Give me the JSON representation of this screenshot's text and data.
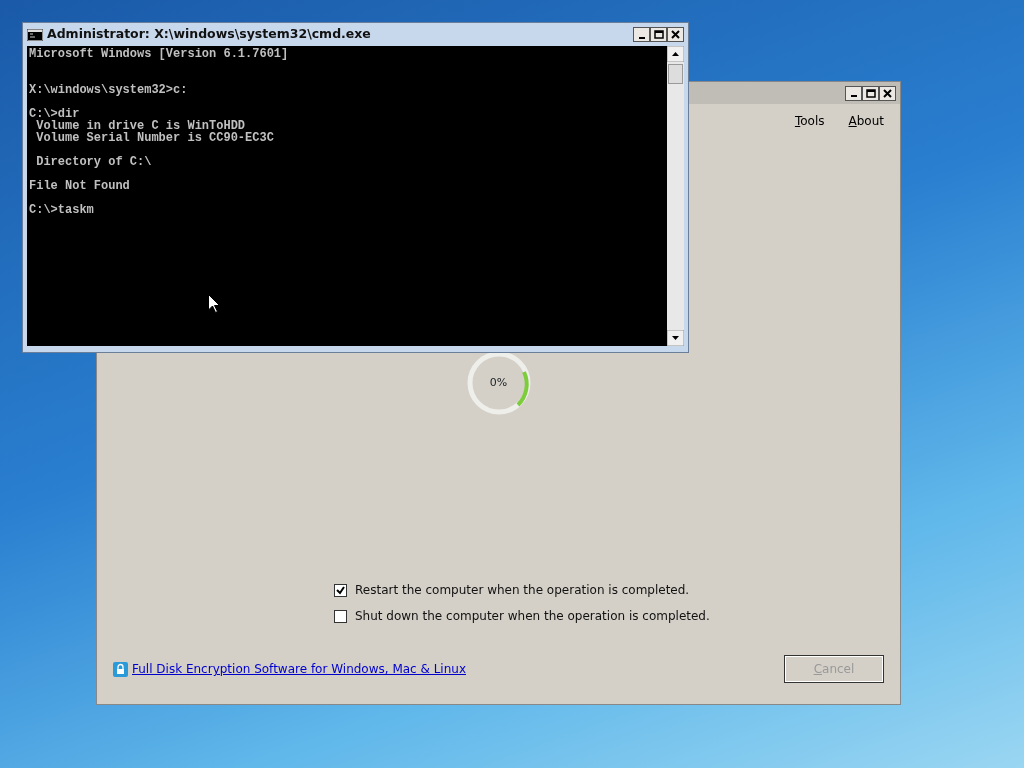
{
  "app_window": {
    "menu": [
      {
        "label": "Tools"
      },
      {
        "label": "About"
      }
    ],
    "progress_text": "0%",
    "options": [
      {
        "label": "Restart the computer when the operation is completed.",
        "checked": true
      },
      {
        "label": "Shut down the computer when the operation is completed.",
        "checked": false
      }
    ],
    "link": "Full Disk Encryption Software for Windows, Mac & Linux",
    "cancel_button": {
      "label": "Cancel",
      "disabled": true
    }
  },
  "console_window": {
    "title": "Administrator: X:\\windows\\system32\\cmd.exe",
    "text": "Microsoft Windows [Version 6.1.7601]\n\n\nX:\\windows\\system32>c:\n\nC:\\>dir\n Volume in drive C is WinToHDD\n Volume Serial Number is CC90-EC3C\n\n Directory of C:\\\n\nFile Not Found\n\nC:\\>taskm"
  }
}
